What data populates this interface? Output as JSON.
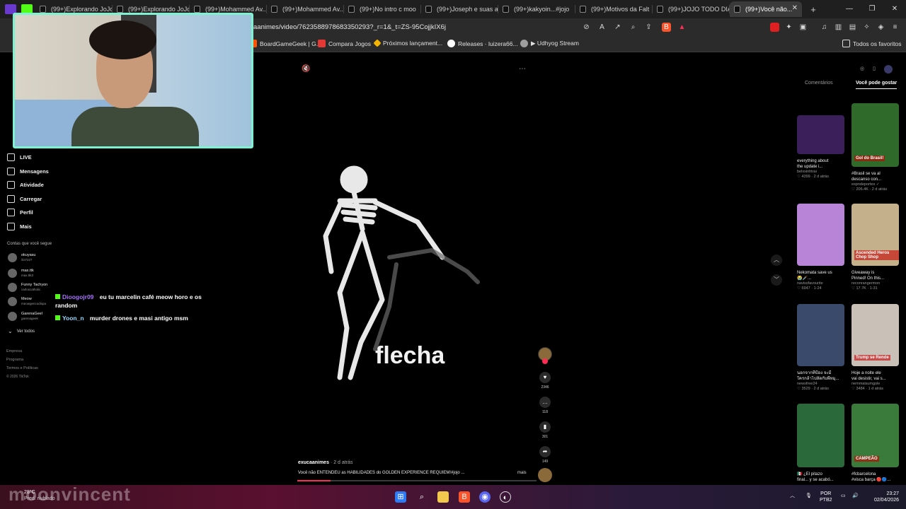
{
  "browser": {
    "tabs": [
      {
        "label": "(99+)Explorando JoJo"
      },
      {
        "label": "(99+)Explorando JoJo"
      },
      {
        "label": "(99+)Mohammed Av..."
      },
      {
        "label": "(99+)Mohammed Av..."
      },
      {
        "label": "(99+)No intro c moo"
      },
      {
        "label": "(99+)Joseph e suas a"
      },
      {
        "label": "(99+)kakyoin...#jojo"
      },
      {
        "label": "(99+)Motivos da Falt"
      },
      {
        "label": "(99+)JOJO TODO DIA"
      },
      {
        "label": "(99+)Você não..."
      }
    ],
    "url": "aanimes/video/7623588978683350293?_r=1&_t=ZS-95CojjkIX6j",
    "bookmarks": [
      {
        "label": "BoardGameGeek | G...",
        "color": "#ff5100"
      },
      {
        "label": "Compara Jogos",
        "color": "#e53935"
      },
      {
        "label": "Próximos lançament...",
        "color": "#f4b400"
      },
      {
        "label": "Releases · luizera66...",
        "color": "#ffffff"
      },
      {
        "label": "▶ Udhyog Stream",
        "color": "#9e9e9e"
      }
    ],
    "favorites_label": "Todos os favoritos"
  },
  "sidebar": {
    "items": [
      {
        "label": "LIVE",
        "icon": "live-icon"
      },
      {
        "label": "Mensagens",
        "icon": "message-icon"
      },
      {
        "label": "Atividade",
        "icon": "activity-icon"
      },
      {
        "label": "Carregar",
        "icon": "upload-icon"
      },
      {
        "label": "Perfil",
        "icon": "profile-icon"
      },
      {
        "label": "Mais",
        "icon": "more-icon"
      }
    ],
    "following_title": "Contas que você segue",
    "following": [
      {
        "name": "okuyasu",
        "handle": "iloi7227"
      },
      {
        "name": "max.ttk",
        "handle": "max.ttk3"
      },
      {
        "name": "Funny Tachyon",
        "handle": "carloscatholic"
      },
      {
        "name": "Meow",
        "handle": "meowgencodispa"
      },
      {
        "name": "GarenaGeel",
        "handle": "garenageek"
      }
    ],
    "see_all": "Ver todos",
    "footer": [
      "Empresa",
      "Programa",
      "Termos e Políticas",
      "© 2026 TikTok"
    ]
  },
  "chat": [
    {
      "user": "Dioogojr09",
      "text": "eu tu marcelin café meow horo e os random"
    },
    {
      "user": "Yoon_n",
      "text": "murder drones e masi antigo msm"
    }
  ],
  "video": {
    "caption": "flecha",
    "author": "exucaanimes",
    "ago": "· 2 d atrás",
    "description": "Você não ENTENDEU as HABILIDADES do GOLDEN EXPERIENCE REQUIEM!#jojo ...",
    "more": "mais",
    "progress": 0.14,
    "likes": "2346",
    "comments": "118",
    "saves": "301",
    "shares": "149"
  },
  "right_panel": {
    "tab_comments": "Comentários",
    "tab_recommend": "Você pode gostar",
    "cards": [
      {
        "title": "everything about",
        "title2": "the update i...",
        "author": "belxxinhtrai",
        "stats": "♡ 4399 · 2 d atrás",
        "color": "#3a1f5a"
      },
      {
        "title": "#Brasil se va al",
        "title2": "descanso con...",
        "author": "espndeportes ✓",
        "stats": "♡ 206.4K · 2 d atrás",
        "color": "#2f6a2a"
      },
      {
        "title": "Nekomata save us",
        "title2": "😭🗡️...",
        "author": "navissfavourite",
        "stats": "♡ 6947 · 1-24",
        "color": "#b784d8"
      },
      {
        "title": "Giveaway is",
        "title2": "Pinned! On this...",
        "author": "reconrangermon",
        "stats": "♡ 17.7K · 1-31",
        "color": "#c4b08a"
      },
      {
        "title": "นอกจากที่ป้อง จะมี",
        "title2": "ใครกล้าไปลัดกับพี่หมุ...",
        "author": "newsfree24",
        "stats": "♡ 3529 · 2 d atrás",
        "color": "#3a4a6a"
      },
      {
        "title": "Hoje a noite ele",
        "title2": "vai desistir, vai s...",
        "author": "nemmaisumgole",
        "stats": "♡ 3484 · 1 d atrás",
        "color": "#c9c1b8"
      },
      {
        "title": "🇲🇽 ¿El pitazo",
        "title2": "final... y se acabó...",
        "author": "",
        "stats": "",
        "color": "#2a6a3a"
      },
      {
        "title": "#fcbarcelona",
        "title2": "#visca barça 🔴🔵...",
        "author": "",
        "stats": "",
        "color": "#3a7a3a"
      }
    ],
    "thumb_texts": [
      "",
      "Gol do Brasil!",
      "",
      "Ascended Heros Chop Shop",
      "",
      "Trump se Rende",
      "",
      "CAMPEÃO"
    ]
  },
  "taskbar": {
    "temp": "28°C",
    "weather": "Pred. nublado",
    "watermark": "moonvincent",
    "lang1": "POR",
    "lang2": "PTB2",
    "time": "23:27",
    "date": "02/04/2026"
  },
  "colors": {
    "accent": "#fe2c55",
    "cam_border": "#7ff0d0"
  }
}
